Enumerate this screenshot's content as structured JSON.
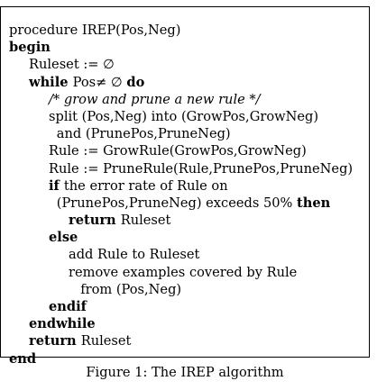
{
  "figure": {
    "lines": [
      {
        "indent": 0,
        "parts": [
          {
            "text": "procedure IREP(Pos,Neg)",
            "style": "normal"
          }
        ]
      },
      {
        "indent": 0,
        "parts": [
          {
            "text": "begin",
            "style": "bold"
          }
        ]
      },
      {
        "indent": 1,
        "parts": [
          {
            "text": "Ruleset := ∅",
            "style": "normal"
          }
        ]
      },
      {
        "indent": 1,
        "parts": [
          {
            "text": "while ",
            "style": "bold"
          },
          {
            "text": "Pos≠ ∅ ",
            "style": "normal"
          },
          {
            "text": "do",
            "style": "bold"
          }
        ]
      },
      {
        "indent": 2,
        "parts": [
          {
            "text": "/* grow and prune a new rule */",
            "style": "italic"
          }
        ]
      },
      {
        "indent": 2,
        "parts": [
          {
            "text": "split (Pos,Neg) into (GrowPos,GrowNeg)",
            "style": "normal"
          }
        ]
      },
      {
        "indent": 2.4,
        "parts": [
          {
            "text": "and (PrunePos,PruneNeg)",
            "style": "normal"
          }
        ]
      },
      {
        "indent": 2,
        "parts": [
          {
            "text": "Rule := GrowRule(GrowPos,GrowNeg)",
            "style": "normal"
          }
        ]
      },
      {
        "indent": 2,
        "parts": [
          {
            "text": "Rule := PruneRule(Rule,PrunePos,PruneNeg)",
            "style": "normal"
          }
        ]
      },
      {
        "indent": 2,
        "parts": [
          {
            "text": "if ",
            "style": "bold"
          },
          {
            "text": "the error rate of Rule on",
            "style": "normal"
          }
        ]
      },
      {
        "indent": 2.4,
        "parts": [
          {
            "text": "(PrunePos,PruneNeg) exceeds 50% ",
            "style": "normal"
          },
          {
            "text": "then",
            "style": "bold"
          }
        ]
      },
      {
        "indent": 3,
        "parts": [
          {
            "text": "return ",
            "style": "bold"
          },
          {
            "text": "Ruleset",
            "style": "normal"
          }
        ]
      },
      {
        "indent": 2,
        "parts": [
          {
            "text": "else",
            "style": "bold"
          }
        ]
      },
      {
        "indent": 3,
        "parts": [
          {
            "text": "add Rule to Ruleset",
            "style": "normal"
          }
        ]
      },
      {
        "indent": 3,
        "parts": [
          {
            "text": "remove examples covered by Rule",
            "style": "normal"
          }
        ]
      },
      {
        "indent": 3.6,
        "parts": [
          {
            "text": "from (Pos,Neg)",
            "style": "normal"
          }
        ]
      },
      {
        "indent": 2,
        "parts": [
          {
            "text": "endif",
            "style": "bold"
          }
        ]
      },
      {
        "indent": 1,
        "parts": [
          {
            "text": "endwhile",
            "style": "bold"
          }
        ]
      },
      {
        "indent": 1,
        "parts": [
          {
            "text": "return ",
            "style": "bold"
          },
          {
            "text": "Ruleset",
            "style": "normal"
          }
        ]
      },
      {
        "indent": 0,
        "parts": [
          {
            "text": "end",
            "style": "bold"
          }
        ]
      }
    ],
    "caption": "Figure 1: The IREP algorithm"
  }
}
